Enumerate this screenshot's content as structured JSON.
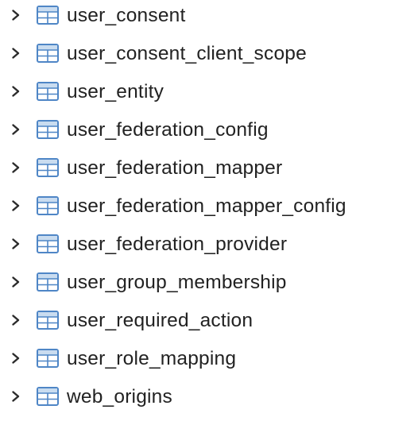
{
  "tree": {
    "items": [
      {
        "label": "user_consent",
        "icon": "table-icon",
        "expand_icon": "chevron-right-icon"
      },
      {
        "label": "user_consent_client_scope",
        "icon": "table-icon",
        "expand_icon": "chevron-right-icon"
      },
      {
        "label": "user_entity",
        "icon": "table-icon",
        "expand_icon": "chevron-right-icon"
      },
      {
        "label": "user_federation_config",
        "icon": "table-icon",
        "expand_icon": "chevron-right-icon"
      },
      {
        "label": "user_federation_mapper",
        "icon": "table-icon",
        "expand_icon": "chevron-right-icon"
      },
      {
        "label": "user_federation_mapper_config",
        "icon": "table-icon",
        "expand_icon": "chevron-right-icon"
      },
      {
        "label": "user_federation_provider",
        "icon": "table-icon",
        "expand_icon": "chevron-right-icon"
      },
      {
        "label": "user_group_membership",
        "icon": "table-icon",
        "expand_icon": "chevron-right-icon"
      },
      {
        "label": "user_required_action",
        "icon": "table-icon",
        "expand_icon": "chevron-right-icon"
      },
      {
        "label": "user_role_mapping",
        "icon": "table-icon",
        "expand_icon": "chevron-right-icon"
      },
      {
        "label": "web_origins",
        "icon": "table-icon",
        "expand_icon": "chevron-right-icon"
      }
    ]
  },
  "colors": {
    "text": "#222222",
    "chevron": "#2b2b2b",
    "icon_stroke": "#4f86c6",
    "icon_header": "#c9dcf0",
    "icon_body": "#ffffff"
  }
}
